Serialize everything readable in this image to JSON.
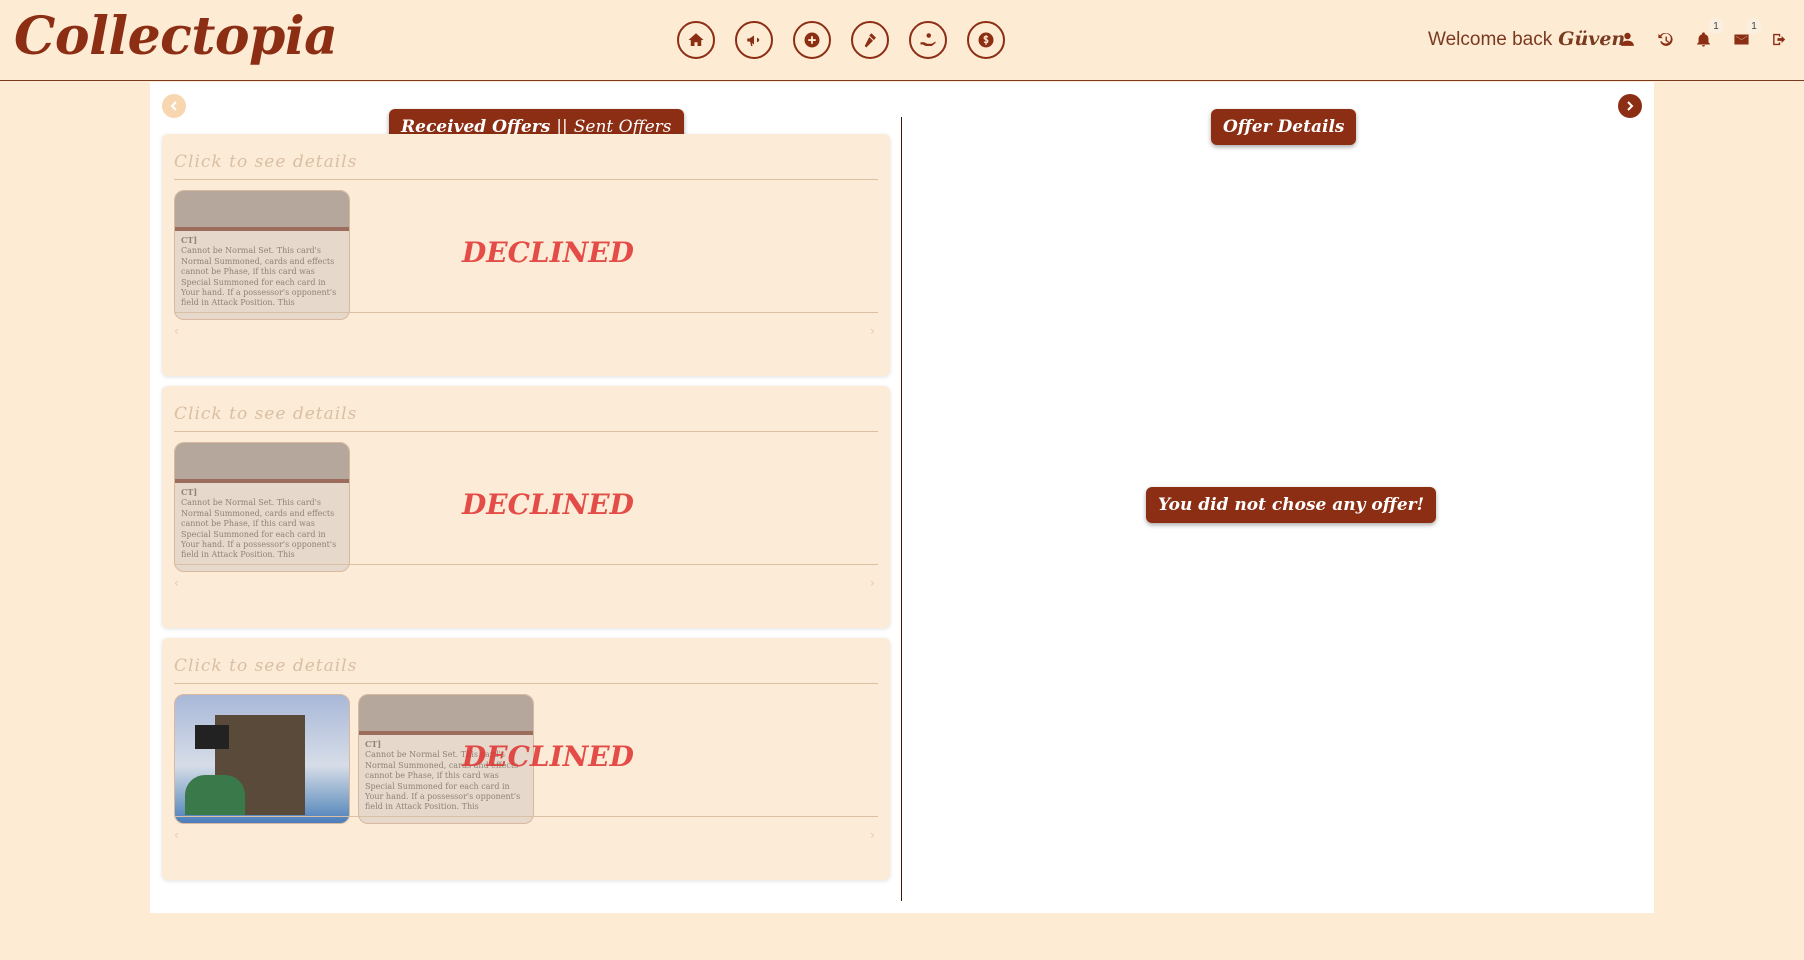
{
  "app": {
    "logo": "Collectopia"
  },
  "nav": [
    {
      "name": "home-icon"
    },
    {
      "name": "megaphone-icon"
    },
    {
      "name": "plus-icon"
    },
    {
      "name": "auction-icon"
    },
    {
      "name": "offer-hand-icon"
    },
    {
      "name": "dollar-coin-icon"
    }
  ],
  "header": {
    "welcome": "Welcome back",
    "username": "Güven",
    "notifications_count": "1",
    "messages_count": "1"
  },
  "tabs": {
    "received": "Received Offers",
    "separator": "||",
    "sent": "Sent Offers"
  },
  "details": {
    "title": "Offer Details",
    "empty_message": "You did not chose any offer!"
  },
  "offers": [
    {
      "title": "Click to see details",
      "status": "DECLINED"
    },
    {
      "title": "Click to see details",
      "status": "DECLINED"
    },
    {
      "title": "Click to see details",
      "status": "DECLINED"
    }
  ],
  "card_text": {
    "title": "CT]",
    "body": "Cannot be Normal Set. This card's Normal Summoned, cards and effects cannot be Phase, if this card was Special Summoned for each card in Your hand. If a possessor's opponent's field in Attack Position. This"
  },
  "colors": {
    "brand": "#8B2E14",
    "page_bg": "#FDEBD3",
    "declined": "#E0312E"
  }
}
